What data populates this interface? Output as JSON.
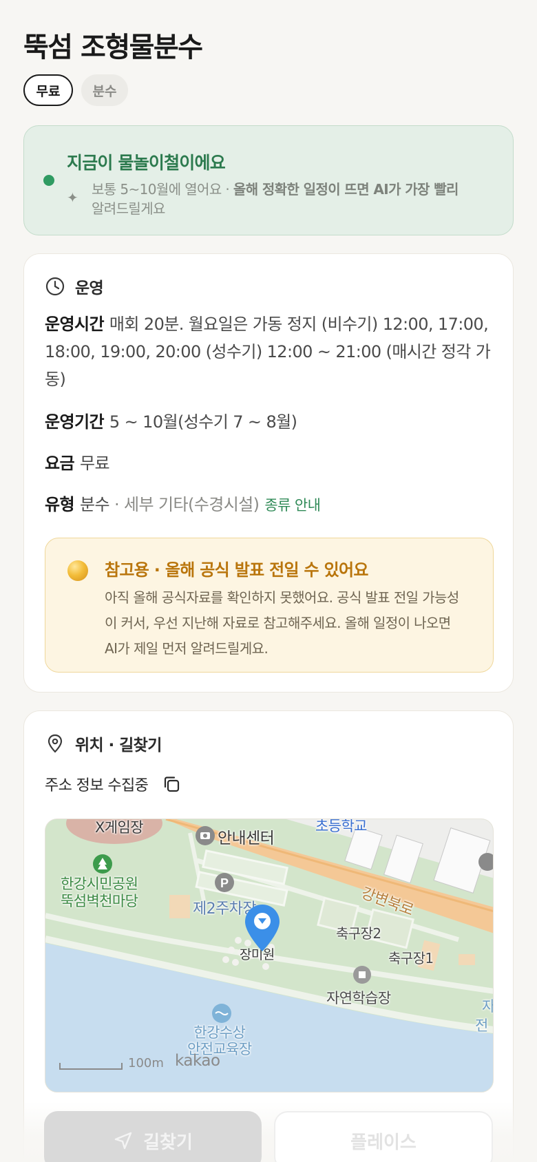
{
  "place": {
    "title": "뚝섬 조형물분수",
    "tags": [
      "무료",
      "분수"
    ]
  },
  "season": {
    "title": "지금이 물놀이철이에요",
    "text_prefix": "보통 5~10월에 열어요 · ",
    "text_bold": "올해 정확한 일정이 뜨면 AI가 가장 빨리",
    "text_suffix": "알려드릴게요"
  },
  "operation": {
    "heading": "운영",
    "hours_key": "운영시간",
    "hours_value": "매회 20분. 월요일은 가동 정지 (비수기) 12:00, 17:00, 18:00, 19:00, 20:00 (성수기) 12:00 ~ 21:00 (매시간 정각 가동)",
    "period_key": "운영기간",
    "period_value": "5 ~ 10월(성수기 7 ~ 8월)",
    "fee_key": "요금",
    "fee_value": "무료",
    "type_key": "유형",
    "type_value": "분수",
    "type_sub": "· 세부 기타(수경시설)",
    "type_link": "종류 안내"
  },
  "notice": {
    "title": "참고용 · 올해 공식 발표 전일 수 있어요",
    "text": "아직 올해 공식자료를 확인하지 못했어요. 공식 발표 전일 가능성이 커서, 우선 지난해 자료로 참고해주세요. 올해 일정이 나오면 AI가 제일 먼저 알려드릴게요."
  },
  "location": {
    "heading": "위치 · 길찾기",
    "address": "주소 정보 수집중",
    "map": {
      "labels": {
        "game": "X게임장",
        "info_center": "안내센터",
        "school": "초등학교",
        "park": "한강시민공원\n뚝섬벽천마당",
        "parking": "제2주차장",
        "road": "강변북로",
        "field2": "축구장2",
        "field1": "축구장1",
        "rose": "장미원",
        "nature": "자연학습장",
        "water": "한강수상\n안전교육장",
        "edge1": "자",
        "edge2": "전"
      },
      "scale": "100m",
      "provider": "kakao"
    }
  },
  "actions": {
    "route": "길찾기",
    "place": "플레이스"
  },
  "colors": {
    "accent_green": "#2f8a57",
    "notice_amber": "#b9750c",
    "marker_blue": "#3b8fe8"
  }
}
